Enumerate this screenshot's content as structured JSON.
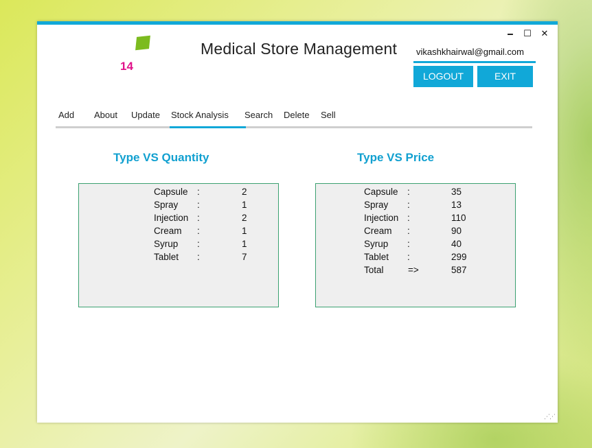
{
  "app": {
    "title": "Medical Store Management",
    "logo_number": "14",
    "user_email": "vikashkhairwal@gmail.com"
  },
  "window_controls": {
    "minimize": "🗕",
    "maximize": "☐",
    "close": "✕"
  },
  "buttons": {
    "logout": "LOGOUT",
    "exit": "EXIT"
  },
  "nav": {
    "items": [
      "Add",
      "About",
      "Update",
      "Stock Analysis",
      "Search",
      "Delete",
      "Sell"
    ],
    "active": "Stock Analysis"
  },
  "quantity_panel": {
    "title": "Type VS Quantity",
    "rows": [
      {
        "type": "Capsule",
        "sep": ":",
        "value": "2"
      },
      {
        "type": "Spray",
        "sep": ":",
        "value": "1"
      },
      {
        "type": "Injection",
        "sep": ":",
        "value": "2"
      },
      {
        "type": "Cream",
        "sep": ":",
        "value": "1"
      },
      {
        "type": "Syrup",
        "sep": ":",
        "value": "1"
      },
      {
        "type": "Tablet",
        "sep": ":",
        "value": "7"
      }
    ]
  },
  "price_panel": {
    "title": "Type VS Price",
    "rows": [
      {
        "type": "Capsule",
        "sep": ":",
        "value": "35"
      },
      {
        "type": "Spray",
        "sep": ":",
        "value": "13"
      },
      {
        "type": "Injection",
        "sep": ":",
        "value": "110"
      },
      {
        "type": "Cream",
        "sep": ":",
        "value": "90"
      },
      {
        "type": "Syrup",
        "sep": ":",
        "value": "40"
      },
      {
        "type": "Tablet",
        "sep": ":",
        "value": "299"
      },
      {
        "type": "Total",
        "sep": "=>",
        "value": "587"
      }
    ]
  },
  "colors": {
    "accent": "#11a8d8",
    "title_blue": "#11a0d0",
    "logo_green": "#7cbb1f",
    "logo_pink": "#e0128a",
    "panel_border": "#3aa070"
  }
}
